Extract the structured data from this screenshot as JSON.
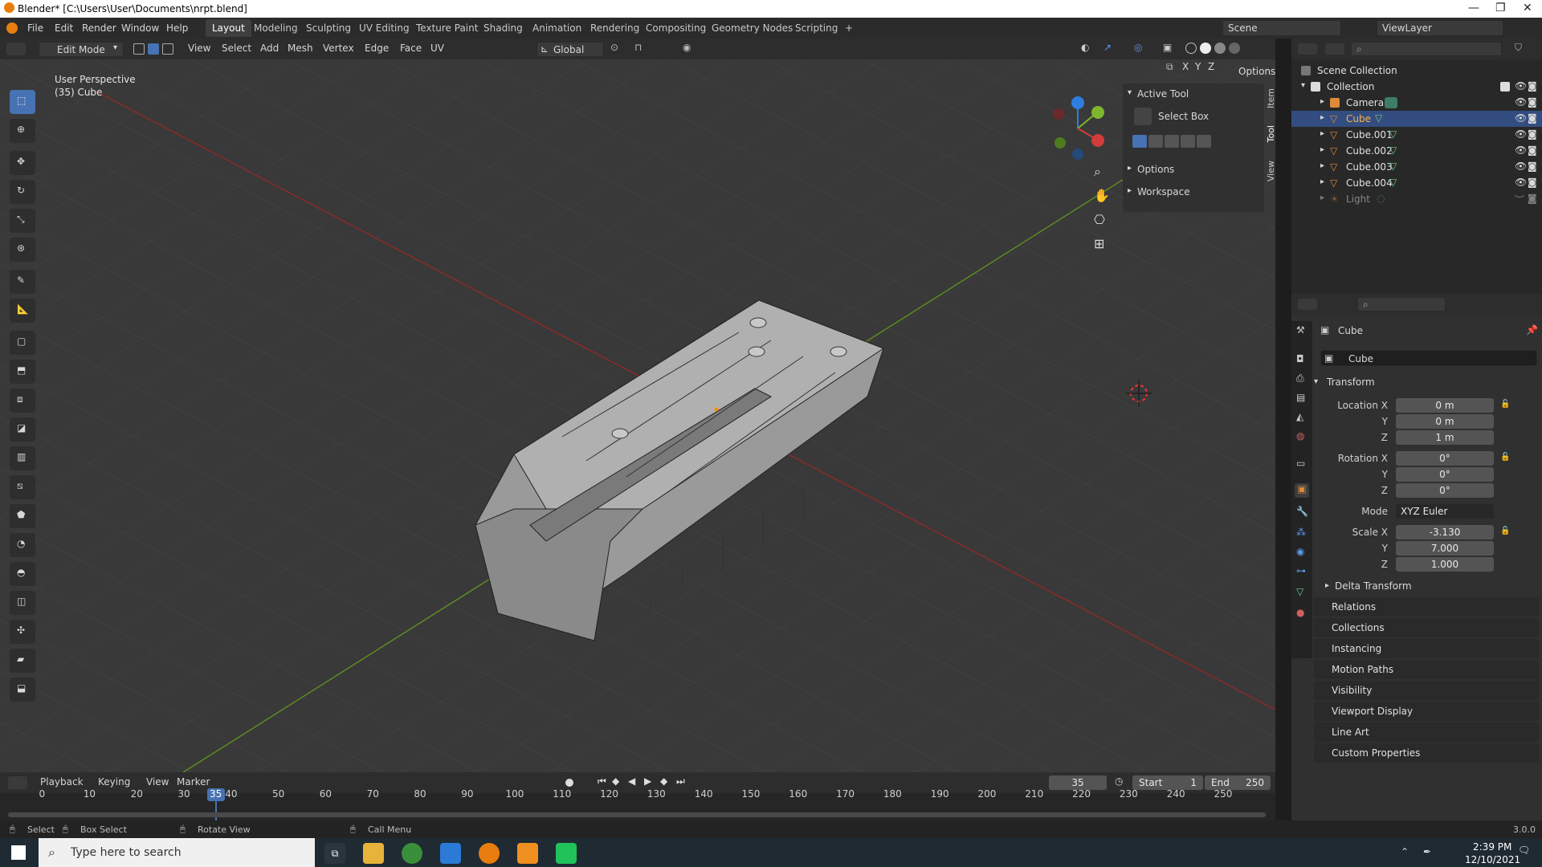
{
  "titlebar": {
    "title": "Blender* [C:\\Users\\User\\Documents\\nrpt.blend]",
    "minimize": "—",
    "maximize": "❐",
    "close": "✕"
  },
  "menu": {
    "items": [
      "File",
      "Edit",
      "Render",
      "Window",
      "Help"
    ]
  },
  "workspaces": [
    "Layout",
    "Modeling",
    "Sculpting",
    "UV Editing",
    "Texture Paint",
    "Shading",
    "Animation",
    "Rendering",
    "Compositing",
    "Geometry Nodes",
    "Scripting",
    "+"
  ],
  "scene": {
    "label": "Scene",
    "viewlayer": "ViewLayer"
  },
  "header3d": {
    "mode": "Edit Mode",
    "menus": [
      "View",
      "Select",
      "Add",
      "Mesh",
      "Vertex",
      "Edge",
      "Face",
      "UV"
    ],
    "orientation": "Global",
    "options": "Options",
    "axes": [
      "X",
      "Y",
      "Z"
    ]
  },
  "viewport": {
    "perspective": "User Perspective",
    "object": "(35) Cube"
  },
  "npanel": {
    "active_tool": "Active Tool",
    "tool_name": "Select Box",
    "options": "Options",
    "workspace": "Workspace",
    "tabs": [
      "Item",
      "Tool",
      "View"
    ]
  },
  "outliner": {
    "scene_collection": "Scene Collection",
    "collection": "Collection",
    "items": [
      {
        "name": "Camera",
        "selected": false
      },
      {
        "name": "Cube",
        "selected": true
      },
      {
        "name": "Cube.001",
        "selected": false
      },
      {
        "name": "Cube.002",
        "selected": false
      },
      {
        "name": "Cube.003",
        "selected": false
      },
      {
        "name": "Cube.004",
        "selected": false
      },
      {
        "name": "Light",
        "selected": false
      }
    ]
  },
  "properties": {
    "object_name": "Cube",
    "data_name": "Cube",
    "transform": "Transform",
    "location": {
      "label": "Location X",
      "x": "0 m",
      "y": "0 m",
      "z": "1 m"
    },
    "rotation": {
      "label": "Rotation X",
      "x": "0°",
      "y": "0°",
      "z": "0°"
    },
    "mode": {
      "label": "Mode",
      "value": "XYZ Euler"
    },
    "scale": {
      "label": "Scale X",
      "x": "-3.130",
      "y": "7.000",
      "z": "1.000"
    },
    "axis_labels": {
      "y": "Y",
      "z": "Z"
    },
    "delta": "Delta Transform",
    "sections": [
      "Relations",
      "Collections",
      "Instancing",
      "Motion Paths",
      "Visibility",
      "Viewport Display",
      "Line Art",
      "Custom Properties"
    ]
  },
  "timeline": {
    "menus": [
      "Playback",
      "Keying",
      "View",
      "Marker"
    ],
    "current": "35",
    "start_label": "Start",
    "start": "1",
    "end_label": "End",
    "end": "250",
    "ticks": [
      "0",
      "10",
      "20",
      "30",
      "40",
      "50",
      "60",
      "70",
      "80",
      "90",
      "100",
      "110",
      "120",
      "130",
      "140",
      "150",
      "160",
      "170",
      "180",
      "190",
      "200",
      "210",
      "220",
      "230",
      "240",
      "250"
    ]
  },
  "statusbar": {
    "select": "Select",
    "box_select": "Box Select",
    "rotate_view": "Rotate View",
    "call_menu": "Call Menu",
    "version": "3.0.0"
  },
  "taskbar": {
    "search_placeholder": "Type here to search",
    "time": "2:39 PM",
    "date": "12/10/2021"
  },
  "colors": {
    "accent": "#4772b3",
    "x_axis": "#d23c3c",
    "y_axis": "#7fb62b",
    "z_axis": "#2c7fe0",
    "viewport_bg": "#393939"
  }
}
